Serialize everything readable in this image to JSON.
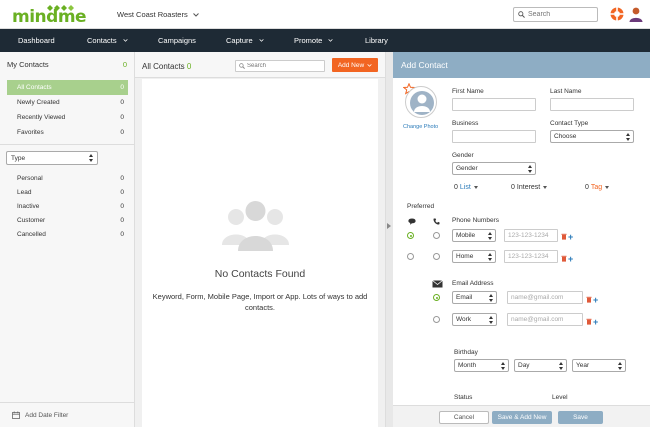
{
  "app": {
    "logo": "mindme",
    "company": "West Coast Roasters",
    "search_placeholder": "Search"
  },
  "nav": {
    "items": [
      {
        "label": "Dashboard",
        "dropdown": false
      },
      {
        "label": "Contacts",
        "dropdown": true
      },
      {
        "label": "Campaigns",
        "dropdown": false
      },
      {
        "label": "Capture",
        "dropdown": true
      },
      {
        "label": "Promote",
        "dropdown": true
      },
      {
        "label": "Library",
        "dropdown": false
      }
    ]
  },
  "sidebar": {
    "title": "My Contacts",
    "title_count": "0",
    "views": [
      {
        "label": "All Contacts",
        "count": "0",
        "active": true
      },
      {
        "label": "Newly Created",
        "count": "0"
      },
      {
        "label": "Recently Viewed",
        "count": "0"
      },
      {
        "label": "Favorites",
        "count": "0"
      }
    ],
    "type_select": "Type",
    "types": [
      {
        "label": "Personal",
        "count": "0"
      },
      {
        "label": "Lead",
        "count": "0"
      },
      {
        "label": "Inactive",
        "count": "0"
      },
      {
        "label": "Customer",
        "count": "0"
      },
      {
        "label": "Cancelled",
        "count": "0"
      }
    ],
    "date_filter": "Add Date Filter"
  },
  "middle": {
    "title": "All Contacts",
    "count": "0",
    "search_placeholder": "Search",
    "add_new": "Add New",
    "empty_title": "No Contacts Found",
    "empty_text": "Keyword, Form, Mobile Page, Import or App. Lots of ways to add contacts."
  },
  "form": {
    "header": "Add Contact",
    "change_photo": "Change Photo",
    "first_name_label": "First Name",
    "last_name_label": "Last Name",
    "business_label": "Business",
    "contact_type_label": "Contact Type",
    "contact_type_value": "Choose",
    "gender_label": "Gender",
    "gender_value": "Gender",
    "list_count": "0",
    "list_label": "List",
    "interest_count": "0",
    "interest_label": "Interest",
    "tag_count": "0",
    "tag_label": "Tag",
    "preferred_label": "Preferred",
    "phone_label": "Phone Numbers",
    "phones": [
      {
        "type": "Mobile",
        "placeholder": "123-123-1234",
        "preferred": true
      },
      {
        "type": "Home",
        "placeholder": "123-123-1234",
        "preferred": false
      }
    ],
    "email_label": "Email Address",
    "emails": [
      {
        "type": "Email",
        "placeholder": "name@gmail.com",
        "preferred": true
      },
      {
        "type": "Work",
        "placeholder": "name@gmail.com",
        "preferred": false
      }
    ],
    "birthday_label": "Birthday",
    "birthday": {
      "month": "Month",
      "day": "Day",
      "year": "Year"
    },
    "status_label": "Status",
    "level_label": "Level",
    "cancel": "Cancel",
    "save_add": "Save & Add New",
    "save": "Save"
  },
  "colors": {
    "brand_green": "#6ab023",
    "nav_bg": "#1e2a35",
    "accent_orange": "#f26522",
    "panel_blue": "#8eadc4",
    "link_blue": "#2b7bb9"
  }
}
